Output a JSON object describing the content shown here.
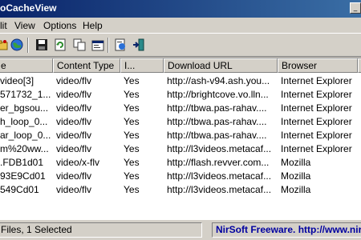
{
  "window": {
    "title": "oCacheView"
  },
  "menu": [
    "lit",
    "View",
    "Options",
    "Help"
  ],
  "toolbar": [
    "open-folder-icon",
    "globe-icon",
    "save-icon",
    "refresh-icon",
    "copy-icon",
    "properties-icon",
    "html-report-icon",
    "exit-icon"
  ],
  "columns": [
    "e",
    "Content Type",
    "I...",
    "Download URL",
    "Browser"
  ],
  "rows": [
    {
      "name": "video[3]",
      "type": "video/flv",
      "indexed": "Yes",
      "url": "http://ash-v94.ash.you...",
      "browser": "Internet Explorer"
    },
    {
      "name": "571732_1...",
      "type": "video/flv",
      "indexed": "Yes",
      "url": "http://brightcove.vo.lln...",
      "browser": "Internet Explorer"
    },
    {
      "name": "er_bgsou...",
      "type": "video/flv",
      "indexed": "Yes",
      "url": "http://tbwa.pas-rahav....",
      "browser": "Internet Explorer"
    },
    {
      "name": "h_loop_0...",
      "type": "video/flv",
      "indexed": "Yes",
      "url": "http://tbwa.pas-rahav....",
      "browser": "Internet Explorer"
    },
    {
      "name": "ar_loop_0...",
      "type": "video/flv",
      "indexed": "Yes",
      "url": "http://tbwa.pas-rahav....",
      "browser": "Internet Explorer"
    },
    {
      "name": "m%20ww...",
      "type": "video/flv",
      "indexed": "Yes",
      "url": "http://l3videos.metacaf...",
      "browser": "Internet Explorer"
    },
    {
      "name": ".FDB1d01",
      "type": "video/x-flv",
      "indexed": "Yes",
      "url": "http://flash.revver.com...",
      "browser": "Mozilla"
    },
    {
      "name": "93E9Cd01",
      "type": "video/flv",
      "indexed": "Yes",
      "url": "http://l3videos.metacaf...",
      "browser": "Mozilla"
    },
    {
      "name": "549Cd01",
      "type": "video/flv",
      "indexed": "Yes",
      "url": "http://l3videos.metacaf...",
      "browser": "Mozilla"
    }
  ],
  "status": {
    "files": "Files, 1 Selected",
    "nirsoft": "NirSoft Freeware.  http://www.nir"
  }
}
